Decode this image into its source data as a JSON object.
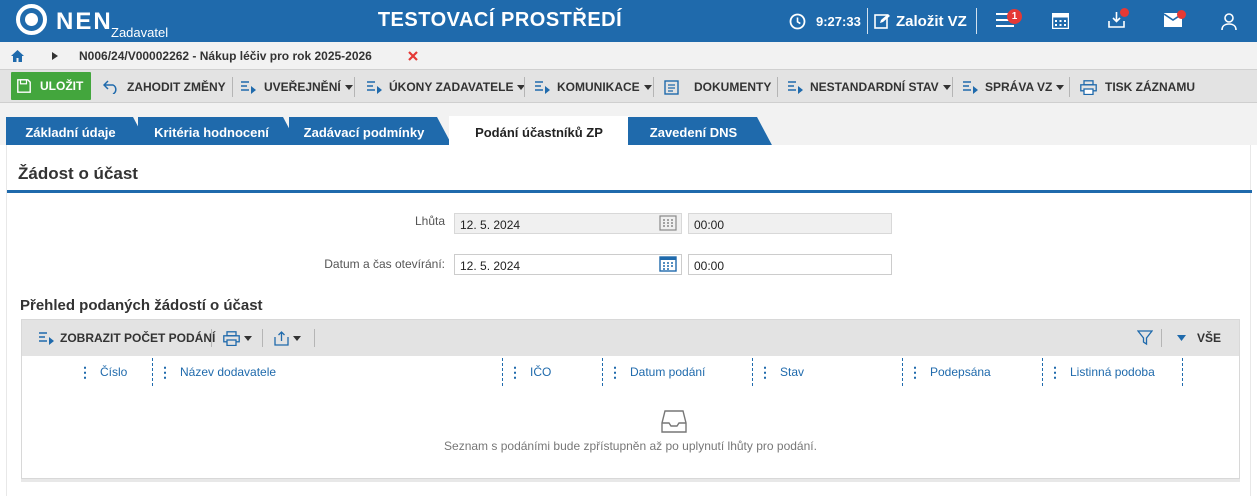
{
  "header": {
    "logo_text": "NEN",
    "logo_sub": "Zadavatel",
    "environment": "TESTOVACÍ PROSTŘEDÍ",
    "time": "9:27:33",
    "create_label": "Založit VZ",
    "notifications_count": "1"
  },
  "breadcrumb": {
    "record": "N006/24/V00002262 - Nákup léčiv pro rok 2025-2026"
  },
  "toolbar": {
    "save": "ULOŽIT",
    "discard": "ZAHODIT ZMĚNY",
    "publish": "UVEŘEJNĚNÍ",
    "acts": "ÚKONY ZADAVATELE",
    "communication": "KOMUNIKACE",
    "documents": "DOKUMENTY",
    "nonstandard": "NESTANDARDNÍ STAV",
    "admin": "SPRÁVA VZ",
    "print": "TISK ZÁZNAMU"
  },
  "tabs": [
    {
      "label": "Základní údaje"
    },
    {
      "label": "Kritéria hodnocení"
    },
    {
      "label": "Zadávací podmínky"
    },
    {
      "label": "Podání účastníků ZP"
    },
    {
      "label": "Zavedení DNS"
    }
  ],
  "section": {
    "title": "Žádost o účast",
    "deadline_label": "Lhůta",
    "deadline_date": "12. 5. 2024",
    "deadline_time": "00:00",
    "opening_label": "Datum a čas otevírání:",
    "opening_date": "12. 5. 2024",
    "opening_time": "00:00"
  },
  "grid": {
    "title": "Přehled podaných žádostí o účast",
    "show_count": "ZOBRAZIT POČET PODÁNÍ",
    "all_label": "VŠE",
    "columns": [
      "Číslo",
      "Název dodavatele",
      "IČO",
      "Datum podání",
      "Stav",
      "Podepsána",
      "Listinná podoba"
    ],
    "empty_text": "Seznam s podáními bude zpřístupněn až po uplynutí lhůty pro podání."
  },
  "colors": {
    "brand_blue": "#1f6aac",
    "save_green": "#43a63d",
    "alert_red": "#e53935"
  }
}
